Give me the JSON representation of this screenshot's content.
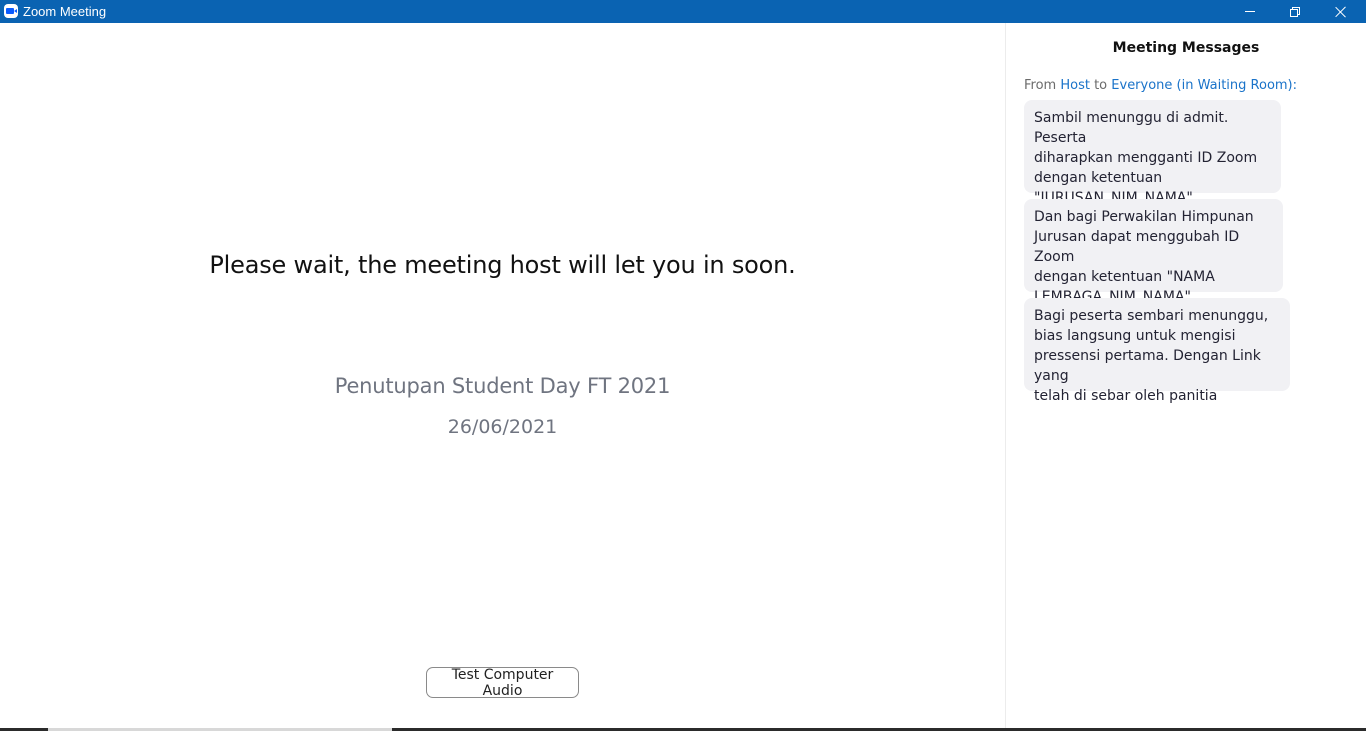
{
  "window": {
    "title": "Zoom Meeting"
  },
  "main": {
    "wait_message": "Please wait, the meeting host will let you in soon.",
    "meeting_topic": "Penutupan Student Day FT 2021",
    "meeting_date": "26/06/2021",
    "test_audio_label": "Test Computer Audio"
  },
  "messages_panel": {
    "title": "Meeting Messages",
    "from_prefix": "From ",
    "sender": "Host",
    "to_word": " to ",
    "recipient": "Everyone (in Waiting Room)",
    "colon": ":",
    "messages": [
      {
        "text": "Sambil menunggu di admit. Peserta\ndiharapkan mengganti ID Zoom\ndengan ketentuan\n\"JURUSAN_NIM_NAMA\""
      },
      {
        "text": "Dan bagi Perwakilan Himpunan\nJurusan dapat menggubah ID Zoom\ndengan ketentuan \"NAMA\nLEMBAGA_NIM_NAMA\""
      },
      {
        "text": "Bagi peserta sembari menunggu,\nbias langsung untuk mengisi\npressensi pertama. Dengan Link yang\ntelah di sebar oleh panitia"
      }
    ]
  },
  "colors": {
    "titlebar": "#0a63b2",
    "link": "#1a73c9",
    "bubble_bg": "#f1f1f4",
    "secondary_text": "#6f7480"
  },
  "icons": {
    "app": "zoom-camera-icon",
    "minimize": "minimize-icon",
    "maximize": "restore-icon",
    "close": "close-icon"
  }
}
